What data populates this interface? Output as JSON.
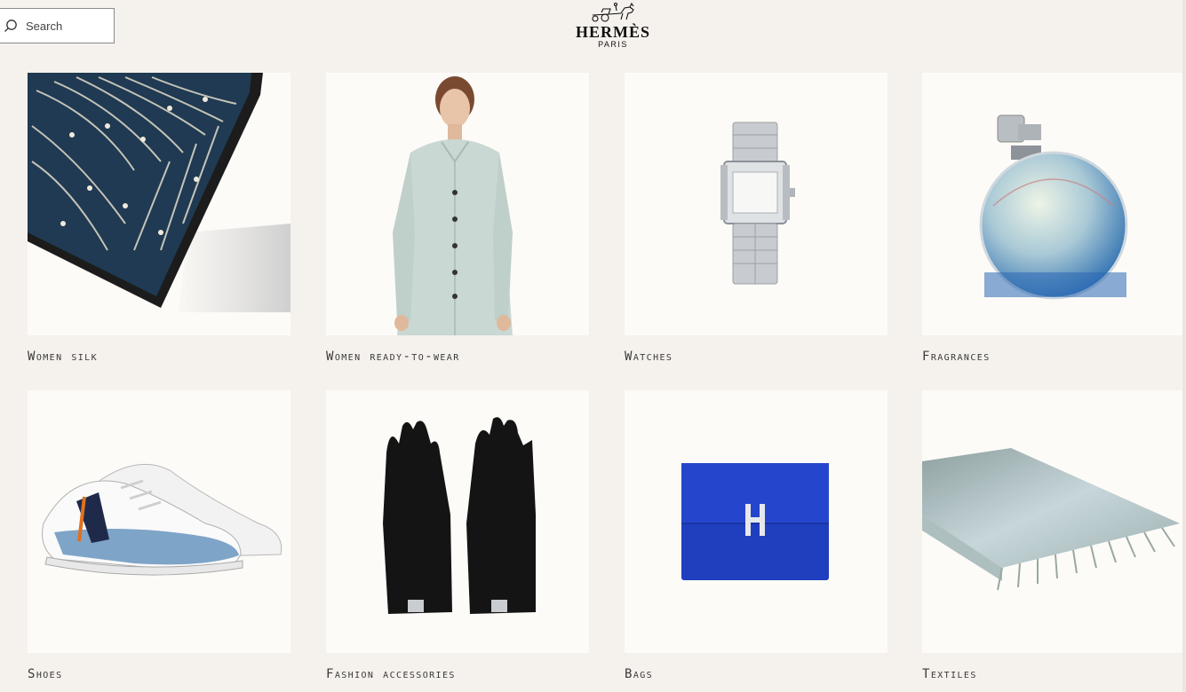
{
  "header": {
    "search_placeholder": "Search",
    "brand": "HERMÈS",
    "city": "PARIS"
  },
  "categories": [
    {
      "label": "Women silk",
      "icon": "silk-scarf-image"
    },
    {
      "label": "Women ready-to-wear",
      "icon": "cardigan-model-image"
    },
    {
      "label": "Watches",
      "icon": "watch-image"
    },
    {
      "label": "Fragrances",
      "icon": "perfume-bottle-image"
    },
    {
      "label": "Shoes",
      "icon": "sneakers-image"
    },
    {
      "label": "Fashion accessories",
      "icon": "gloves-image"
    },
    {
      "label": "Bags",
      "icon": "wallet-image"
    },
    {
      "label": "Textiles",
      "icon": "blanket-image"
    }
  ],
  "colors": {
    "background": "#f5f1ec",
    "card": "#fdfbf7",
    "scarf_navy": "#1f3a52",
    "bag_blue": "#1f3fbf",
    "cardigan_mint": "#c9d8d3"
  }
}
